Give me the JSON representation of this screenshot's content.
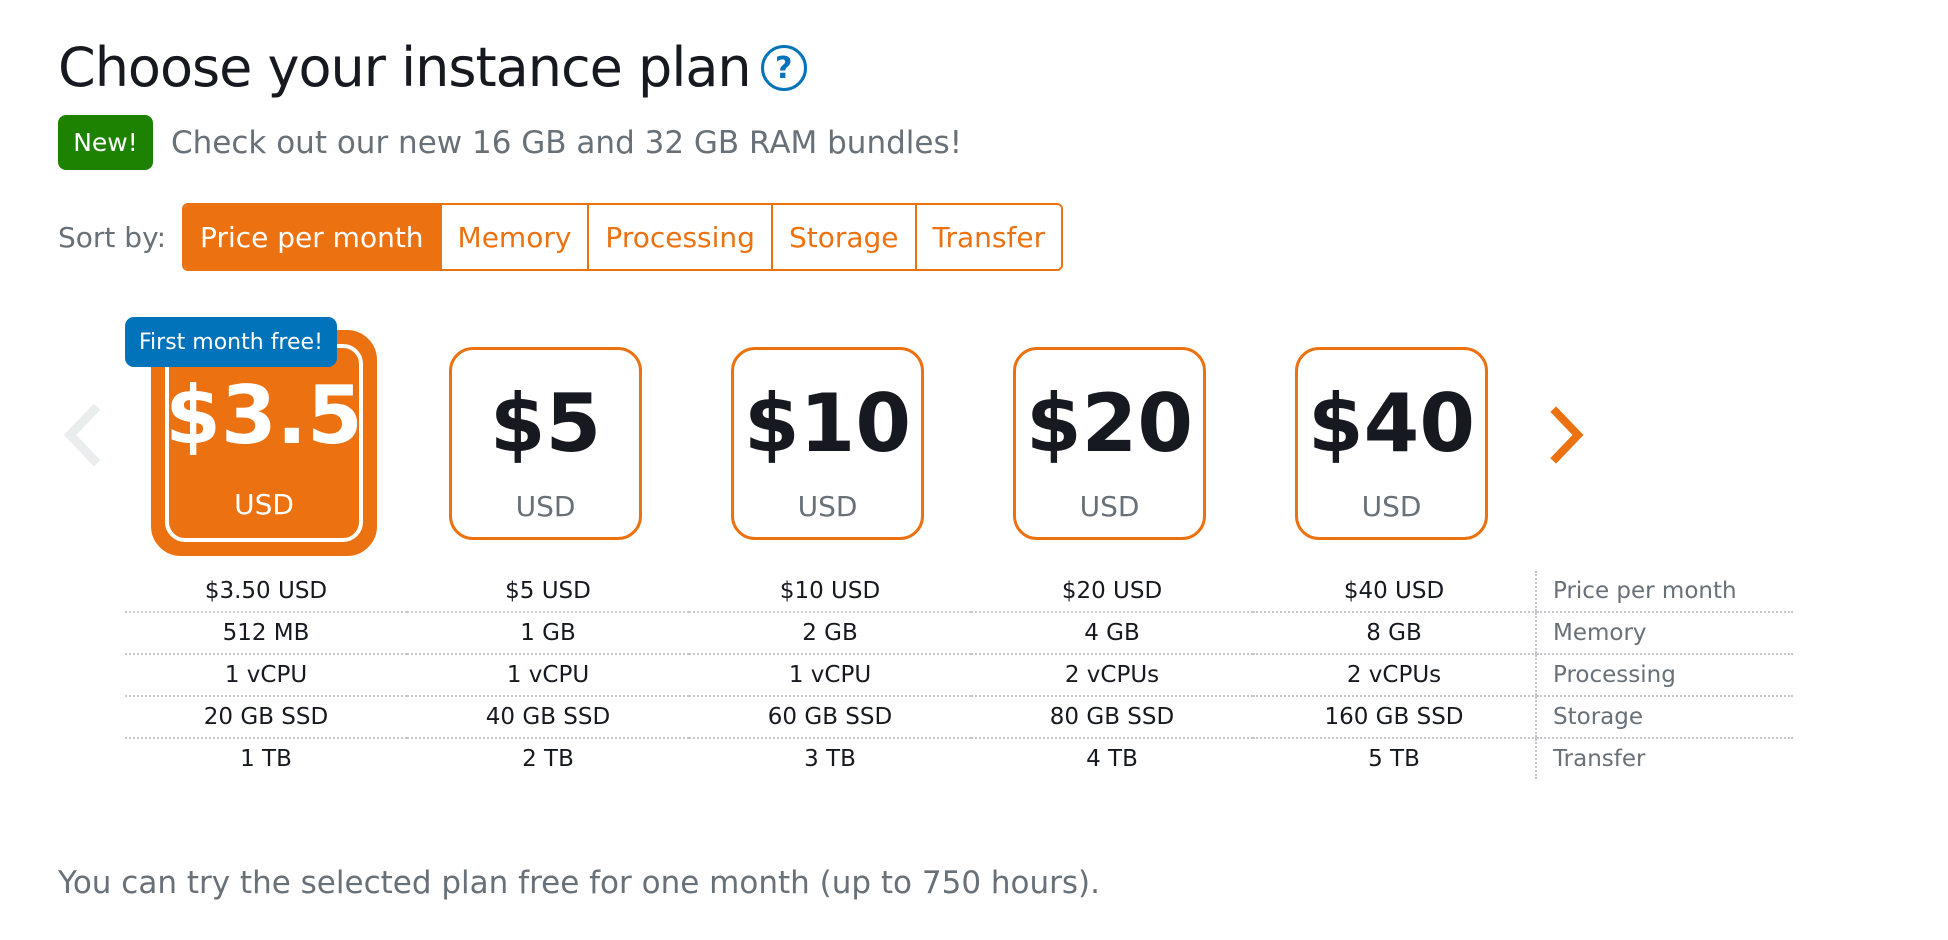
{
  "header": {
    "title": "Choose your instance plan",
    "help_icon": "question-circle-icon"
  },
  "announcement": {
    "badge": "New!",
    "text": "Check out our new 16 GB and 32 GB RAM bundles!",
    "badge_color": "#1d8102"
  },
  "sort": {
    "label": "Sort by:",
    "options": [
      "Price per month",
      "Memory",
      "Processing",
      "Storage",
      "Transfer"
    ],
    "selected": "Price per month"
  },
  "carousel": {
    "prev_icon": "chevron-left-icon",
    "next_icon": "chevron-right-icon"
  },
  "plans": [
    {
      "price": "$3.5",
      "currency": "USD",
      "selected": true,
      "promo": "First month free!"
    },
    {
      "price": "$5",
      "currency": "USD",
      "selected": false
    },
    {
      "price": "$10",
      "currency": "USD",
      "selected": false
    },
    {
      "price": "$20",
      "currency": "USD",
      "selected": false
    },
    {
      "price": "$40",
      "currency": "USD",
      "selected": false
    }
  ],
  "specs": {
    "rows": [
      {
        "label": "Price per month",
        "values": [
          "$3.50 USD",
          "$5 USD",
          "$10 USD",
          "$20 USD",
          "$40 USD"
        ]
      },
      {
        "label": "Memory",
        "values": [
          "512 MB",
          "1 GB",
          "2 GB",
          "4 GB",
          "8 GB"
        ]
      },
      {
        "label": "Processing",
        "values": [
          "1 vCPU",
          "1 vCPU",
          "1 vCPU",
          "2 vCPUs",
          "2 vCPUs"
        ]
      },
      {
        "label": "Storage",
        "values": [
          "20 GB SSD",
          "40 GB SSD",
          "60 GB SSD",
          "80 GB SSD",
          "160 GB SSD"
        ]
      },
      {
        "label": "Transfer",
        "values": [
          "1 TB",
          "2 TB",
          "3 TB",
          "4 TB",
          "5 TB"
        ]
      }
    ]
  },
  "footer": {
    "note": "You can try the selected plan free for one month (up to 750 hours)."
  },
  "colors": {
    "accent": "#ec7211",
    "info": "#0073bb",
    "success": "#1d8102",
    "muted_text": "#687078",
    "text": "#16191f"
  }
}
